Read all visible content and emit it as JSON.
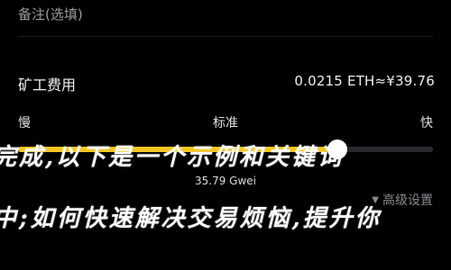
{
  "memo": {
    "placeholder": "备注(选填)"
  },
  "fee": {
    "label": "矿工费用",
    "value": "0.0215 ETH≈¥39.76"
  },
  "speed": {
    "slow": "慢",
    "standard": "标准",
    "fast": "快",
    "level_percent": 77
  },
  "gas_price": "35.79 Gwei",
  "advanced": {
    "label": "高级设置",
    "icon": "chevron-down-icon"
  },
  "overlay_text": {
    "line1": "完成,以下是一个示例和关键词",
    "line2": "中;如何快速解决交易烦恼,提升你"
  },
  "colors": {
    "background": "#000000",
    "slider_fill": "#f3c623",
    "slider_track": "#2a2a2e",
    "thumb": "#ffffff"
  }
}
